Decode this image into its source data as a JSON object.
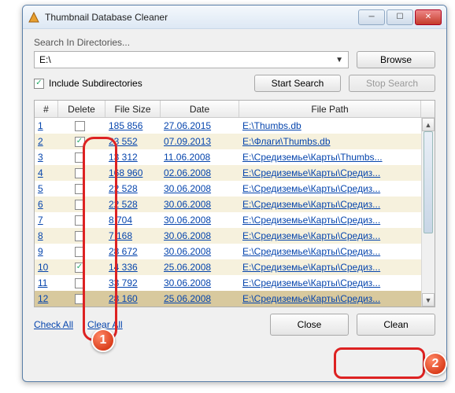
{
  "window": {
    "title": "Thumbnail Database Cleaner"
  },
  "section": {
    "label": "Search In Directories..."
  },
  "path": {
    "value": "E:\\",
    "browse": "Browse"
  },
  "include": {
    "label": "Include Subdirectories",
    "checked": true
  },
  "actions": {
    "start": "Start Search",
    "stop": "Stop Search"
  },
  "columns": {
    "num": "#",
    "del": "Delete",
    "size": "File Size",
    "date": "Date",
    "path": "File Path"
  },
  "rows": [
    {
      "n": "1",
      "chk": false,
      "size": "185 856",
      "date": "27.06.2015",
      "path": "E:\\Thumbs.db"
    },
    {
      "n": "2",
      "chk": true,
      "size": "23 552",
      "date": "07.09.2013",
      "path": "E:\\Флаги\\Thumbs.db"
    },
    {
      "n": "3",
      "chk": false,
      "size": "13 312",
      "date": "11.06.2008",
      "path": "E:\\Средиземье\\Карты\\Thumbs..."
    },
    {
      "n": "4",
      "chk": false,
      "size": "168 960",
      "date": "02.06.2008",
      "path": "E:\\Средиземье\\Карты\\Средиз..."
    },
    {
      "n": "5",
      "chk": false,
      "size": "22 528",
      "date": "30.06.2008",
      "path": "E:\\Средиземье\\Карты\\Средиз..."
    },
    {
      "n": "6",
      "chk": false,
      "size": "22 528",
      "date": "30.06.2008",
      "path": "E:\\Средиземье\\Карты\\Средиз..."
    },
    {
      "n": "7",
      "chk": false,
      "size": "8 704",
      "date": "30.06.2008",
      "path": "E:\\Средиземье\\Карты\\Средиз..."
    },
    {
      "n": "8",
      "chk": false,
      "size": "7 168",
      "date": "30.06.2008",
      "path": "E:\\Средиземье\\Карты\\Средиз..."
    },
    {
      "n": "9",
      "chk": false,
      "size": "28 672",
      "date": "30.06.2008",
      "path": "E:\\Средиземье\\Карты\\Средиз..."
    },
    {
      "n": "10",
      "chk": true,
      "size": "14 336",
      "date": "25.06.2008",
      "path": "E:\\Средиземье\\Карты\\Средиз..."
    },
    {
      "n": "11",
      "chk": false,
      "size": "33 792",
      "date": "30.06.2008",
      "path": "E:\\Средиземье\\Карты\\Средиз..."
    },
    {
      "n": "12",
      "chk": false,
      "size": "28 160",
      "date": "25.06.2008",
      "path": "E:\\Средиземье\\Карты\\Средиз...",
      "selected": true
    }
  ],
  "links": {
    "check_all": "Check All",
    "clear_all": "Clear All"
  },
  "footer": {
    "close": "Close",
    "clean": "Clean"
  },
  "badges": {
    "one": "1",
    "two": "2"
  }
}
